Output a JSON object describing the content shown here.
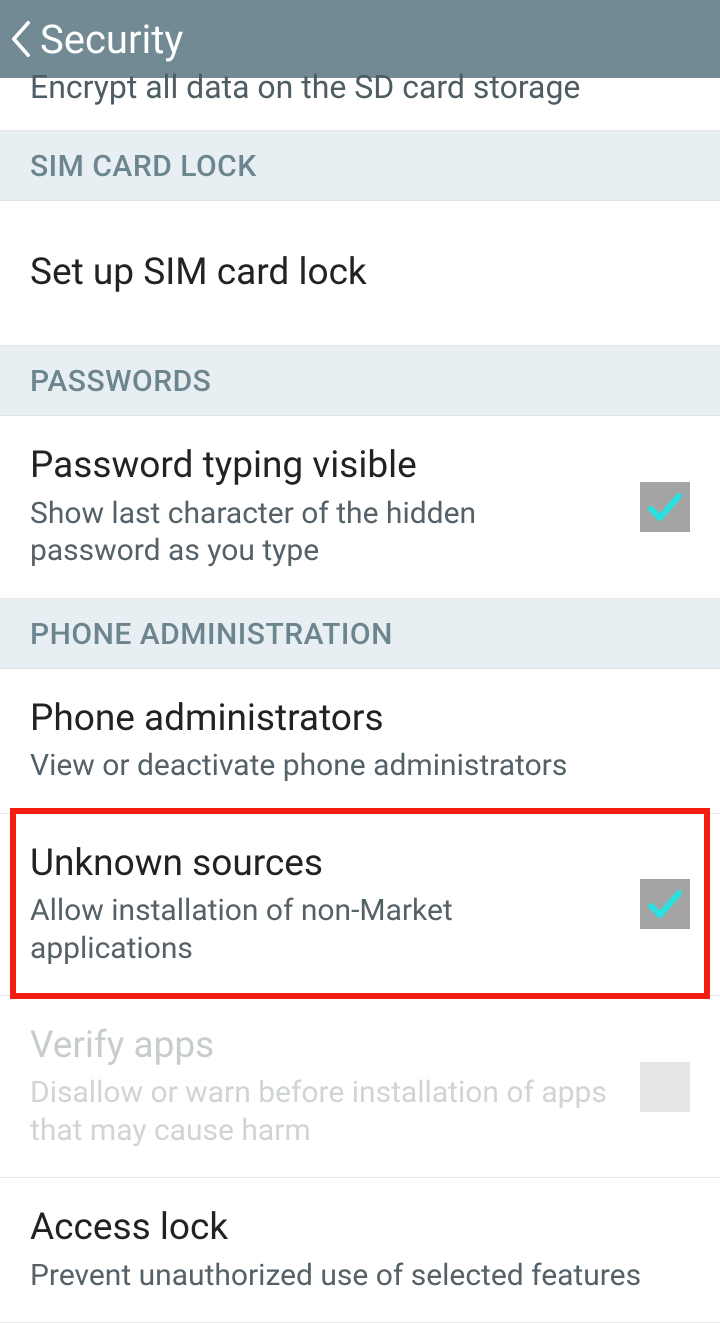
{
  "header": {
    "title": "Security"
  },
  "partial": {
    "text": "Encrypt all data on the SD card storage"
  },
  "sections": {
    "sim_card_lock": {
      "header": "SIM CARD LOCK",
      "item": {
        "title": "Set up SIM card lock"
      }
    },
    "passwords": {
      "header": "PASSWORDS",
      "item": {
        "title": "Password typing visible",
        "sub": "Show last character of the hidden password as you type"
      }
    },
    "phone_admin": {
      "header": "PHONE ADMINISTRATION",
      "admins": {
        "title": "Phone administrators",
        "sub": "View or deactivate phone administrators"
      },
      "unknown": {
        "title": "Unknown sources",
        "sub": "Allow installation of non-Market applications"
      },
      "verify": {
        "title": "Verify apps",
        "sub": "Disallow or warn before installation of apps that may cause harm"
      },
      "access": {
        "title": "Access lock",
        "sub": "Prevent unauthorized use of selected features"
      }
    }
  }
}
